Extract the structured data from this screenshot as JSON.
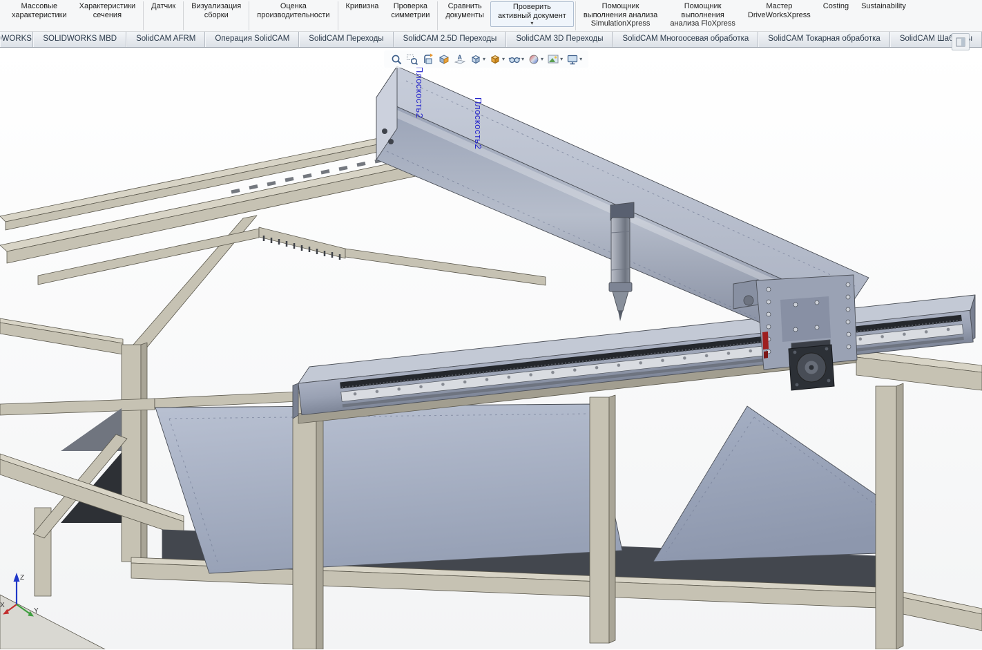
{
  "ribbon": {
    "items": [
      {
        "l1": "Массовые",
        "l2": "характеристики"
      },
      {
        "l1": "Характеристики",
        "l2": "сечения"
      },
      {
        "l1": "Датчик"
      },
      {
        "l1": "Визуализация",
        "l2": "сборки"
      },
      {
        "l1": "Оценка",
        "l2": "производительности"
      },
      {
        "l1": "Кривизна"
      },
      {
        "l1": "Проверка",
        "l2": "симметрии"
      },
      {
        "l1": "Сравнить",
        "l2": "документы"
      },
      {
        "l1": "Проверить",
        "l2": "активный документ",
        "caret": "▾"
      },
      {
        "l1": "Помощник",
        "l2": "выполнения анализа",
        "l3": "SimulationXpress"
      },
      {
        "l1": "Помощник",
        "l2": "выполнения",
        "l3": "анализа FloXpress"
      },
      {
        "l1": "Мастер",
        "l2": "DriveWorksXpress"
      },
      {
        "l1": "Costing"
      },
      {
        "l1": "Sustainability"
      }
    ]
  },
  "tabs": {
    "labels": [
      "SOLIDWORKS",
      "SOLIDWORKS MBD",
      "SolidCAM AFRM",
      "Операция  SolidCAM",
      "SolidCAM Переходы",
      "SolidCAM 2.5D Переходы",
      "SolidCAM 3D Переходы",
      "SolidCAM Многоосевая обработка",
      "SolidCAM Токарная обработка",
      "SolidCAM Шаблоны"
    ]
  },
  "viewtoolbar": {
    "caret": "▾",
    "icons": [
      "zoom-to-fit",
      "zoom-to-area",
      "previous-view",
      "section-view",
      "dynamic-annotation-views",
      "view-orientation",
      "display-style",
      "hide-show-items",
      "edit-appearance",
      "apply-scene",
      "view-settings"
    ]
  },
  "viewport": {
    "plane_label_1": "Плоскость2",
    "plane_label_2": "Плоскость2",
    "triad": {
      "x": "X",
      "y": "Y",
      "z": "Z"
    },
    "colors": {
      "frame": "#c6c2b3",
      "sheet_metal": "#a9b2c6",
      "gantry": "#9fa7ba",
      "plane_label": "#2323cb"
    }
  }
}
